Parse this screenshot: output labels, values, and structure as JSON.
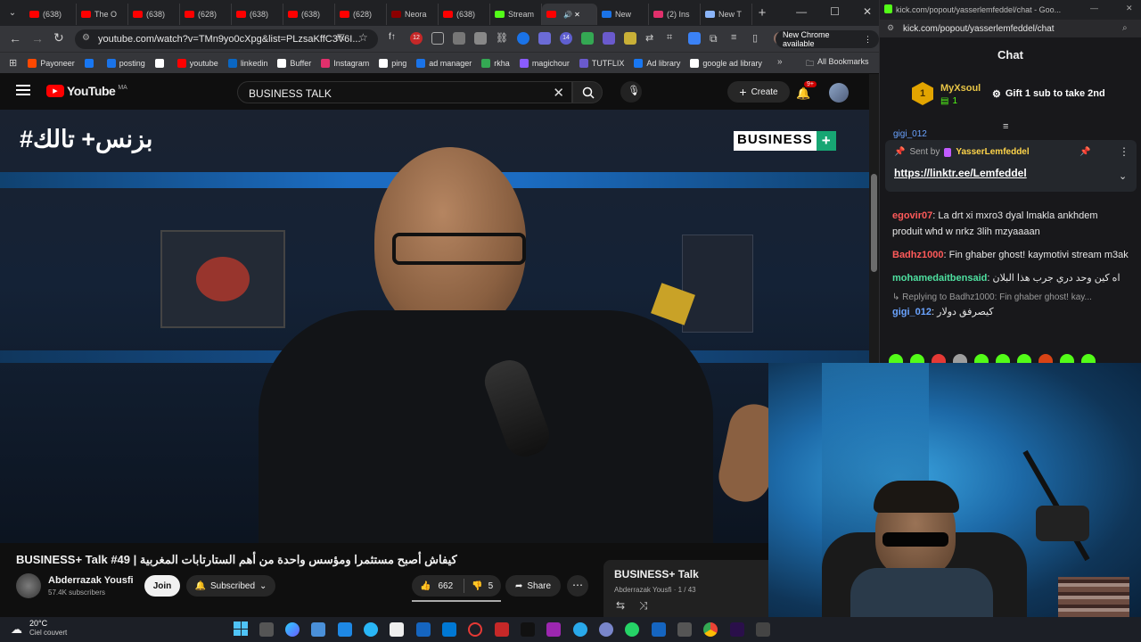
{
  "chrome": {
    "tabs": [
      {
        "label": "(638)",
        "color": "#ff0000"
      },
      {
        "label": "The O",
        "color": "#ff0000"
      },
      {
        "label": "(638)",
        "color": "#ff0000"
      },
      {
        "label": "(628)",
        "color": "#ff0000"
      },
      {
        "label": "(638)",
        "color": "#ff0000"
      },
      {
        "label": "(638)",
        "color": "#ff0000"
      },
      {
        "label": "(628)",
        "color": "#ff0000"
      },
      {
        "label": "Neora",
        "color": "#8b0000"
      },
      {
        "label": "(638)",
        "color": "#ff0000"
      },
      {
        "label": "Stream",
        "color": "#53fc18"
      },
      {
        "label": "",
        "color": "#ff0000",
        "active": true
      },
      {
        "label": "New",
        "color": "#1a73e8"
      },
      {
        "label": "(2) Ins",
        "color": "#e1306c"
      },
      {
        "label": "New T",
        "color": "#8ab4f8"
      }
    ],
    "url": "youtube.com/watch?v=TMn9yo0cXpg&list=PLzsaKffC3V6I...",
    "update_button": "New Chrome available",
    "extension_badges": {
      "ext1": "12",
      "ext2": "14"
    },
    "bookmarks": [
      {
        "label": "Payoneer",
        "color": "#ff4800"
      },
      {
        "label": "",
        "color": "#1877f2"
      },
      {
        "label": "posting",
        "color": "#1a73e8"
      },
      {
        "label": "",
        "color": "#ffffff"
      },
      {
        "label": "youtube",
        "color": "#ff0000"
      },
      {
        "label": "linkedin",
        "color": "#0a66c2"
      },
      {
        "label": "Buffer",
        "color": "#ffffff"
      },
      {
        "label": "Instagram",
        "color": "#e1306c"
      },
      {
        "label": "ping",
        "color": "#ffffff"
      },
      {
        "label": "ad manager",
        "color": "#1a73e8"
      },
      {
        "label": "rkha",
        "color": "#34a853"
      },
      {
        "label": "magichour",
        "color": "#8a5cff"
      },
      {
        "label": "TUTFLIX",
        "color": "#6a5acd"
      },
      {
        "label": "Ad library",
        "color": "#1877f2"
      },
      {
        "label": "google ad library",
        "color": "#ffffff"
      }
    ],
    "all_bookmarks": "All Bookmarks"
  },
  "youtube": {
    "logo": "YouTube",
    "region": "MA",
    "search_value": "BUSINESS TALK",
    "create_label": "Create",
    "notifications": "9+",
    "video_overlay_left": "#بزنس+ تالك",
    "video_overlay_right": "BUSINESS",
    "video_title": "BUSINESS+ Talk #49 | كيفاش أصبح مستثمرا ومؤسس واحدة من أهم الستارتابات المغربية",
    "channel_name": "Abderrazak Yousfi",
    "subscribers": "57.4K subscribers",
    "join_label": "Join",
    "subscribed_label": "Subscribed",
    "likes": "662",
    "dislikes": "5",
    "share_label": "Share",
    "playlist_title": "BUSINESS+ Talk",
    "playlist_sub": "Abderrazak Yousfi · 1 / 43"
  },
  "kick": {
    "window_title": "kick.com/popout/yasserlemfeddel/chat - Goo...",
    "url": "kick.com/popout/yasserlemfeddel/chat",
    "chat_title": "Chat",
    "sub_user": "MyXsoul",
    "sub_rank": "1",
    "sub_count": "1",
    "gift_text": "Gift 1 sub to take 2nd",
    "pinned_partial_user": "gigi_012",
    "pinned_sent_by": "Sent by",
    "pinned_author": "YasserLemfeddel",
    "pinned_link": "https://linktr.ee/Lemfeddel",
    "messages": [
      {
        "user": "egovir07",
        "color": "#ff5a5a",
        "text": "La drt xi mxro3 dyal lmakla ankhdem produit whd w nrkz 3lih mzyaaaan"
      },
      {
        "user": "Badhz1000",
        "color": "#ff5a5a",
        "text": "Fin ghaber ghost! kaymotivi stream m3ak"
      },
      {
        "user": "mohamedaitbensaid",
        "color": "#4ee0a0",
        "text": "اه كين وحد دري جرب هذا البلان"
      }
    ],
    "reply_note": "Replying to Badhz1000: Fin ghaber ghost! kay...",
    "reply_user": "gigi_012",
    "reply_text": "كيصرفق دولار"
  },
  "taskbar": {
    "temp": "20°C",
    "weather": "Ciel couvert"
  }
}
